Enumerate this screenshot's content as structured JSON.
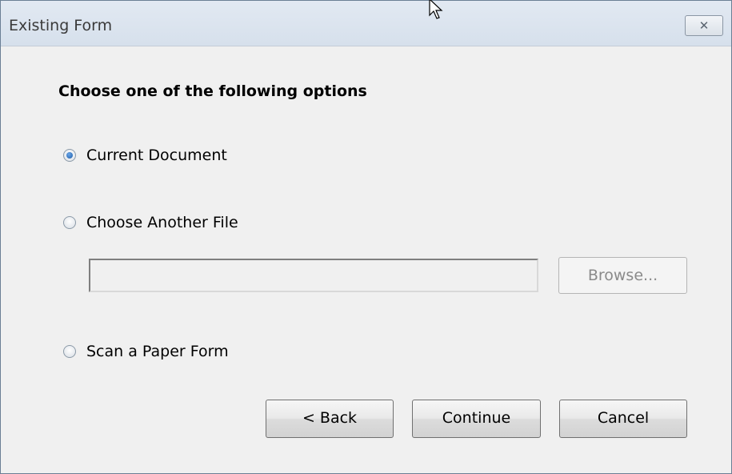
{
  "window": {
    "title": "Existing Form",
    "close_icon": "close-icon"
  },
  "heading": "Choose one of the following options",
  "options": [
    {
      "label": "Current Document",
      "selected": true
    },
    {
      "label": "Choose Another File",
      "selected": false
    },
    {
      "label": "Scan a Paper Form",
      "selected": false
    }
  ],
  "file_path": {
    "value": "",
    "placeholder": ""
  },
  "buttons": {
    "browse": "Browse...",
    "back": "< Back",
    "continue": "Continue",
    "cancel": "Cancel"
  }
}
